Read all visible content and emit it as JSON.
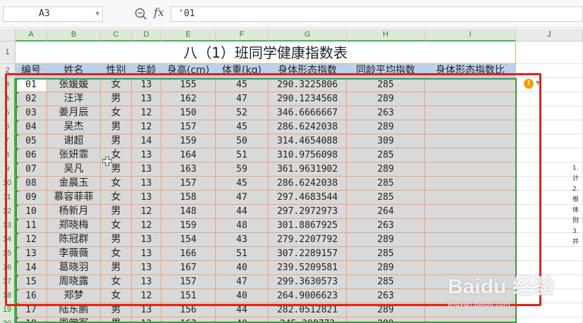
{
  "formula_bar": {
    "name_box": "A3",
    "formula": "'01"
  },
  "columns": [
    "A",
    "B",
    "C",
    "D",
    "E",
    "F",
    "G",
    "H",
    "I",
    "J"
  ],
  "rows": [
    "1",
    "2",
    "3",
    "4",
    "5",
    "6",
    "7",
    "8",
    "9",
    "10",
    "11",
    "12",
    "13",
    "14",
    "15",
    "16",
    "17",
    "18",
    "19",
    "20"
  ],
  "title": "八（1）班同学健康指数表",
  "headers": [
    "编号",
    "姓名",
    "性别",
    "年龄",
    "身高(cm)",
    "体重(kg)",
    "身体形态指数",
    "同龄平均指数",
    "身体形态指数比"
  ],
  "table": [
    [
      "01",
      "张媛媛",
      "女",
      "13",
      "155",
      "45",
      "290.3225806",
      "285"
    ],
    [
      "02",
      "汪洋",
      "男",
      "13",
      "162",
      "47",
      "290.1234568",
      "289"
    ],
    [
      "03",
      "姜月辰",
      "女",
      "12",
      "150",
      "52",
      "346.6666667",
      "263"
    ],
    [
      "04",
      "吴杰",
      "男",
      "12",
      "157",
      "45",
      "286.6242038",
      "289"
    ],
    [
      "05",
      "谢超",
      "男",
      "14",
      "159",
      "50",
      "314.4654088",
      "309"
    ],
    [
      "06",
      "张妍霏",
      "女",
      "13",
      "164",
      "51",
      "310.9756098",
      "285"
    ],
    [
      "07",
      "吴凡",
      "男",
      "13",
      "163",
      "59",
      "361.9631902",
      "289"
    ],
    [
      "08",
      "金晨玉",
      "女",
      "13",
      "157",
      "45",
      "286.6242038",
      "285"
    ],
    [
      "09",
      "慕容菲菲",
      "女",
      "13",
      "158",
      "47",
      "297.4683544",
      "285"
    ],
    [
      "10",
      "杨新月",
      "男",
      "12",
      "148",
      "44",
      "297.2972973",
      "264"
    ],
    [
      "11",
      "郑晓梅",
      "女",
      "12",
      "159",
      "48",
      "301.8867925",
      "263"
    ],
    [
      "12",
      "陈冠群",
      "男",
      "13",
      "154",
      "43",
      "279.2207792",
      "289"
    ],
    [
      "13",
      "李薇薇",
      "女",
      "13",
      "166",
      "51",
      "307.2289157",
      "285"
    ],
    [
      "14",
      "葛晓羽",
      "男",
      "13",
      "167",
      "40",
      "239.5209581",
      "289"
    ],
    [
      "15",
      "周晓露",
      "女",
      "13",
      "157",
      "47",
      "299.3630573",
      "285"
    ],
    [
      "16",
      "郑梦",
      "女",
      "12",
      "151",
      "40",
      "264.9006623",
      "263"
    ],
    [
      "17",
      "陆东鹏",
      "男",
      "13",
      "156",
      "44",
      "282.0512821",
      "289"
    ],
    [
      "18",
      "周堂军",
      "男",
      "13",
      "163",
      "40",
      "245.398773",
      "289"
    ]
  ],
  "side_notes": [
    "1.计",
    "2.根",
    "体则",
    "3.并"
  ],
  "watermark": {
    "text": "Baidu 经验",
    "url": "jingyan.baidu.com"
  },
  "colors": {
    "header_fill": "#b7d3ec",
    "body_fill": "#d9d9d9",
    "cell_border": "#e6a57a",
    "selection": "#3b9a3b",
    "highlight_box": "#e0201a"
  }
}
